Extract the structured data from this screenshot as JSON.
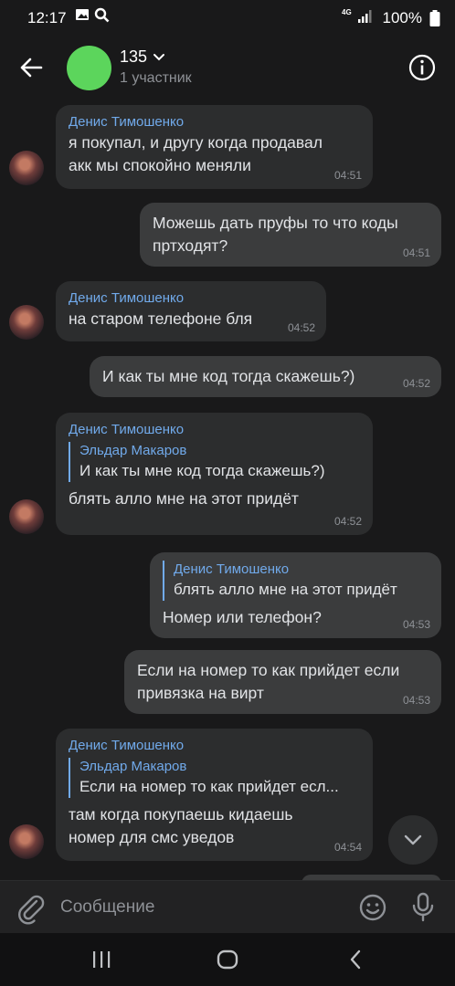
{
  "status_bar": {
    "time": "12:17",
    "network": "4G",
    "battery": "100%"
  },
  "header": {
    "title": "135",
    "subtitle": "1 участник",
    "avatar_color": "#5cd55c"
  },
  "messages": [
    {
      "direction": "in",
      "sender": "Денис Тимошенко",
      "lines": [
        "я покупал, и другу когда продавал",
        "акк мы спокойно меняли"
      ],
      "time": "04:51"
    },
    {
      "direction": "out",
      "lines": [
        "Можешь дать пруфы то что коды",
        "пртходят?"
      ],
      "time": "04:51"
    },
    {
      "direction": "in",
      "sender": "Денис Тимошенко",
      "lines": [
        "на старом телефоне бля"
      ],
      "time": "04:52"
    },
    {
      "direction": "out",
      "lines": [
        "И как ты мне код тогда скажешь?)"
      ],
      "time": "04:52"
    },
    {
      "direction": "in",
      "sender": "Денис Тимошенко",
      "reply": {
        "name": "Эльдар Макаров",
        "text": "И как ты мне код тогда скажешь?)"
      },
      "lines": [
        "блять алло мне на этот придёт"
      ],
      "time": "04:52"
    },
    {
      "direction": "out",
      "reply": {
        "name": "Денис Тимошенко",
        "text": "блять алло мне на этот придёт"
      },
      "lines": [
        "Номер или телефон?"
      ],
      "time": "04:53"
    },
    {
      "direction": "out",
      "lines": [
        "Если на номер то как прийдет если",
        "привязка на вирт"
      ],
      "time": "04:53"
    },
    {
      "direction": "in",
      "sender": "Денис Тимошенко",
      "reply": {
        "name": "Эльдар Макаров",
        "text": "Если на номер то как прийдет есл..."
      },
      "lines": [
        "там когда покупаешь кидаешь",
        "номер для смс уведов"
      ],
      "time": "04:54"
    }
  ],
  "input": {
    "placeholder": "Сообщение"
  },
  "colors": {
    "background": "#19191a",
    "bubble_in": "#2c2d2e",
    "bubble_out": "#3b3c3d",
    "accent": "#71aaeb"
  }
}
